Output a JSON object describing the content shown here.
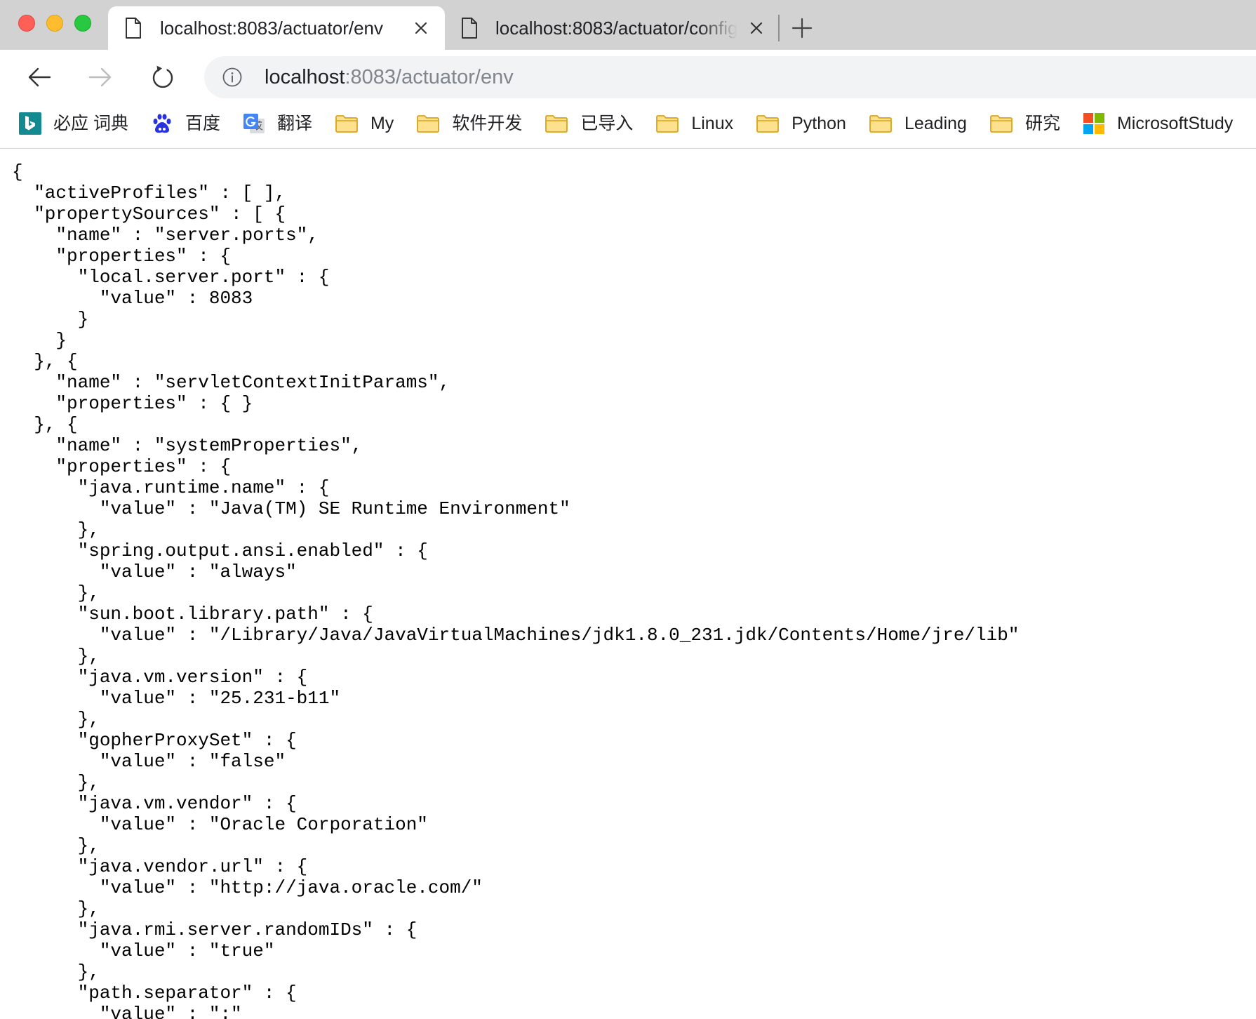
{
  "tabs": [
    {
      "title": "localhost:8083/actuator/env",
      "active": true
    },
    {
      "title": "localhost:8083/actuator/config",
      "active": false
    }
  ],
  "toolbar": {
    "url_host": "localhost",
    "url_rest": ":8083/actuator/env"
  },
  "bookmarks": {
    "items": [
      {
        "label": "必应 词典",
        "icon": "bing-icon"
      },
      {
        "label": "百度",
        "icon": "baidu-icon"
      },
      {
        "label": "翻译",
        "icon": "google-translate-icon"
      },
      {
        "label": "My",
        "icon": "folder-icon"
      },
      {
        "label": "软件开发",
        "icon": "folder-icon"
      },
      {
        "label": "已导入",
        "icon": "folder-icon"
      },
      {
        "label": "Linux",
        "icon": "folder-icon"
      },
      {
        "label": "Python",
        "icon": "folder-icon"
      },
      {
        "label": "Leading",
        "icon": "folder-icon"
      },
      {
        "label": "研究",
        "icon": "folder-icon"
      },
      {
        "label": "MicrosoftStudy",
        "icon": "microsoft-icon"
      },
      {
        "icon": "folder-icon"
      }
    ]
  },
  "content": {
    "lines": [
      "{",
      "  \"activeProfiles\" : [ ],",
      "  \"propertySources\" : [ {",
      "    \"name\" : \"server.ports\",",
      "    \"properties\" : {",
      "      \"local.server.port\" : {",
      "        \"value\" : 8083",
      "      }",
      "    }",
      "  }, {",
      "    \"name\" : \"servletContextInitParams\",",
      "    \"properties\" : { }",
      "  }, {",
      "    \"name\" : \"systemProperties\",",
      "    \"properties\" : {",
      "      \"java.runtime.name\" : {",
      "        \"value\" : \"Java(TM) SE Runtime Environment\"",
      "      },",
      "      \"spring.output.ansi.enabled\" : {",
      "        \"value\" : \"always\"",
      "      },",
      "      \"sun.boot.library.path\" : {",
      "        \"value\" : \"/Library/Java/JavaVirtualMachines/jdk1.8.0_231.jdk/Contents/Home/jre/lib\"",
      "      },",
      "      \"java.vm.version\" : {",
      "        \"value\" : \"25.231-b11\"",
      "      },",
      "      \"gopherProxySet\" : {",
      "        \"value\" : \"false\"",
      "      },",
      "      \"java.vm.vendor\" : {",
      "        \"value\" : \"Oracle Corporation\"",
      "      },",
      "      \"java.vendor.url\" : {",
      "        \"value\" : \"http://java.oracle.com/\"",
      "      },",
      "      \"java.rmi.server.randomIDs\" : {",
      "        \"value\" : \"true\"",
      "      },",
      "      \"path.separator\" : {",
      "        \"value\" : \":\""
    ]
  },
  "colors": {
    "tab_bar": "#d2d2d2",
    "toolbar": "#ffffff",
    "omnibox": "#f1f3f4",
    "traffic_close": "#fe5f57",
    "traffic_minimize": "#febc2e",
    "traffic_zoom": "#28c840",
    "text_primary": "#202124",
    "text_muted": "#80868b",
    "icon_disabled": "#bdbdbd",
    "divider": "#d4d4d4",
    "folder_fill": "#fde18c",
    "folder_stroke": "#d9a41b",
    "bing": "#138a8f",
    "baidu": "#2932e1",
    "google_blue": "#4285f4",
    "ms_red": "#f25022",
    "ms_green": "#7fba00",
    "ms_blue": "#00a4ef",
    "ms_yellow": "#ffb900"
  }
}
